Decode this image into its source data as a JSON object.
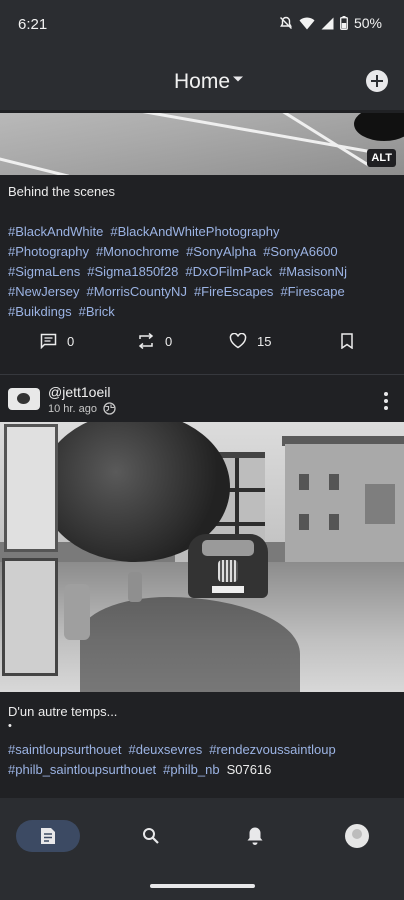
{
  "status_bar": {
    "time": "6:21",
    "battery": "50%",
    "icons": [
      "mute-icon",
      "wifi-icon",
      "signal-icon",
      "battery-icon"
    ]
  },
  "app_bar": {
    "title": "Home",
    "icons": [
      "dropdown-caret-icon",
      "add-circle-icon"
    ]
  },
  "posts": [
    {
      "image_alt_badge": "ALT",
      "caption": "Behind the scenes",
      "hashtags": [
        "#BlackAndWhite",
        "#BlackAndWhitePhotography",
        "#Photography",
        "#Monochrome",
        "#SonyAlpha",
        "#SonyA6600",
        "#SigmaLens",
        "#Sigma1850f28",
        "#DxOFilmPack",
        "#MasisonNj",
        "#NewJersey",
        "#MorrisCountyNJ",
        "#FireEscapes",
        "#Firescape",
        "#Buikdings",
        "#Brick"
      ],
      "actions": {
        "replies": "0",
        "reblogs": "0",
        "favourites": "15"
      }
    },
    {
      "author": "@jett1oeil",
      "time_ago": "10 hr. ago",
      "caption": "D'un autre temps...",
      "caption_bullet": "•",
      "hashtags": [
        "#saintloupsurthouet",
        "#deuxsevres",
        "#rendezvoussaintloup",
        "#philb_saintloupsurthouet",
        "#philb_nb"
      ],
      "trailing_text": "S07616"
    }
  ],
  "bottom_nav": {
    "items": [
      "feed-icon",
      "search-icon",
      "notifications-icon",
      "profile-avatar"
    ],
    "active": "feed-icon"
  },
  "colors": {
    "background": "#202124",
    "bars": "#2b2d31",
    "hashtag": "#9bb3e3",
    "active_nav": "#3c4a63"
  }
}
